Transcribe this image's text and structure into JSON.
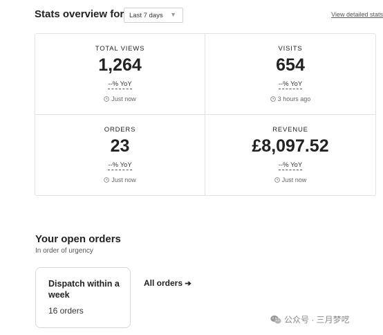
{
  "header": {
    "title": "Stats overview for",
    "period_selected": "Last 7 days",
    "view_detailed_link": "View detailed stats"
  },
  "stats": [
    {
      "label": "TOTAL VIEWS",
      "value": "1,264",
      "yoy": "--% YoY",
      "updated": "Just now"
    },
    {
      "label": "VISITS",
      "value": "654",
      "yoy": "--% YoY",
      "updated": "3 hours ago"
    },
    {
      "label": "ORDERS",
      "value": "23",
      "yoy": "--% YoY",
      "updated": "Just now"
    },
    {
      "label": "REVENUE",
      "value": "£8,097.52",
      "yoy": "--% YoY",
      "updated": "Just now"
    }
  ],
  "orders": {
    "title": "Your open orders",
    "subtitle": "In order of urgency",
    "card": {
      "title": "Dispatch within a week",
      "count": "16 orders"
    },
    "all_orders_label": "All orders",
    "all_orders_arrow": "➔"
  },
  "watermark": {
    "text": "公众号 · 三月梦呓",
    "icon": "wechat-icon"
  },
  "icons": {
    "dropdown": "chevron-down-icon",
    "clock": "clock-icon"
  }
}
